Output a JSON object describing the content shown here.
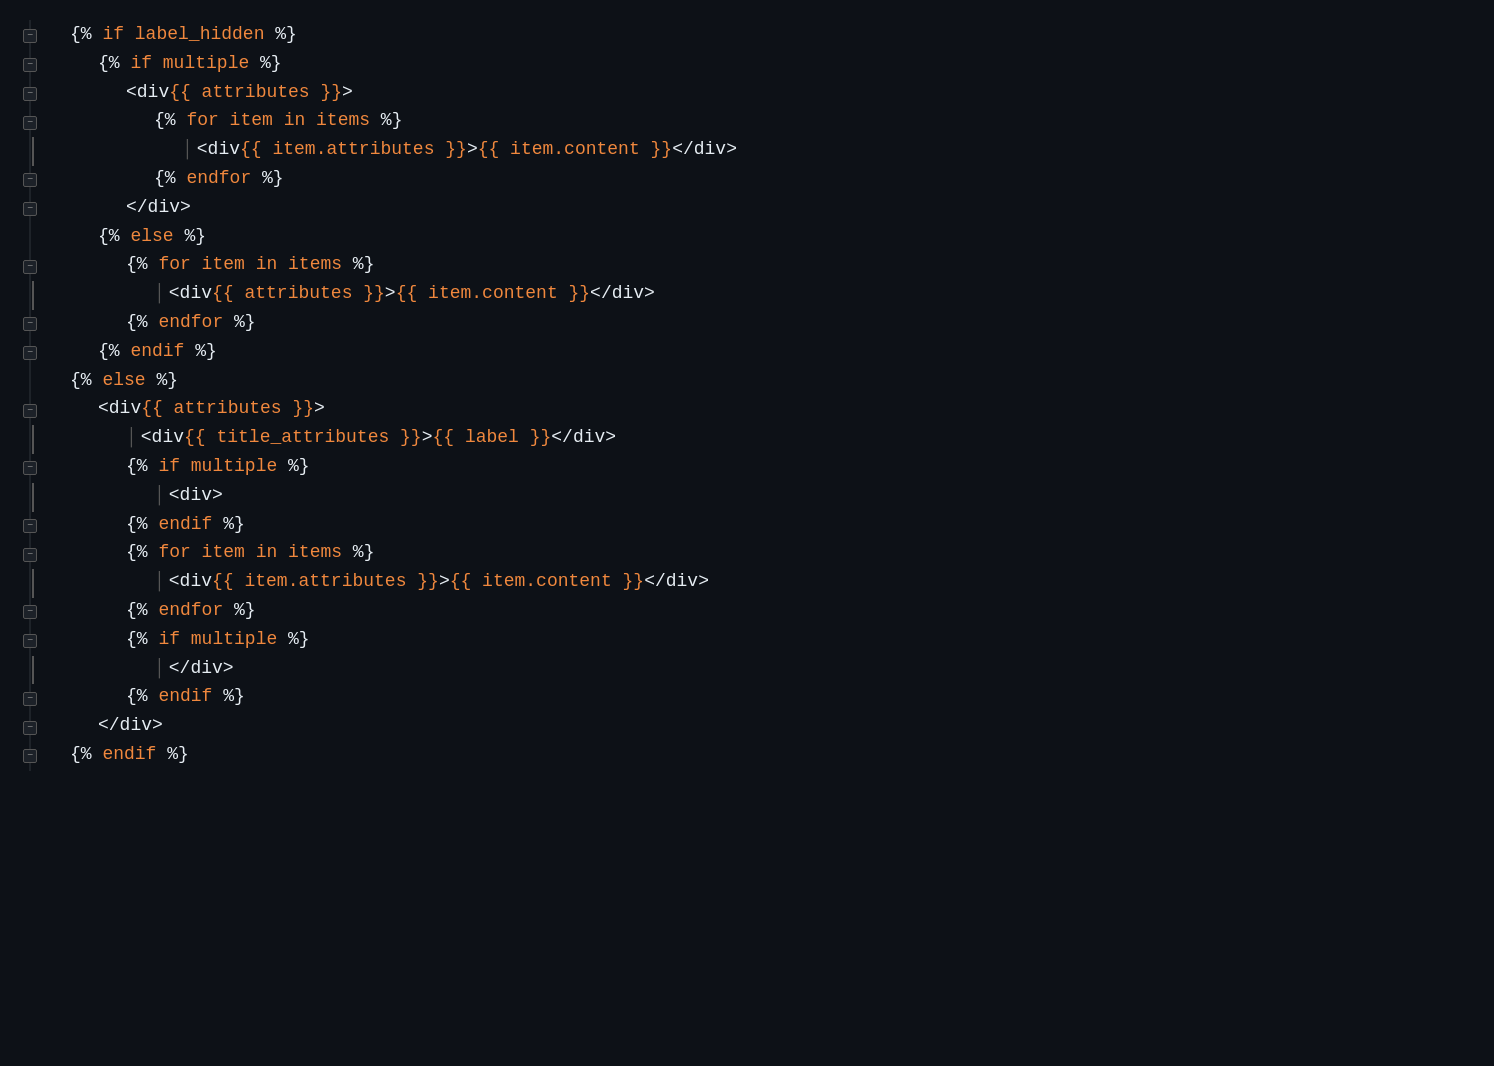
{
  "colors": {
    "bg": "#0d1117",
    "white": "#e6edf3",
    "orange": "#f0883e",
    "blue": "#79c0ff",
    "keyword": "#ff7b72",
    "gutter_line": "#30363d"
  },
  "lines": [
    {
      "indent": 0,
      "fold": "minus",
      "tokens": [
        {
          "c": "white",
          "t": "{%"
        },
        {
          "c": "orange",
          "t": " if label_hidden "
        },
        {
          "c": "white",
          "t": "%}"
        }
      ]
    },
    {
      "indent": 1,
      "fold": "minus",
      "tokens": [
        {
          "c": "white",
          "t": "{%"
        },
        {
          "c": "orange",
          "t": " if multiple "
        },
        {
          "c": "white",
          "t": "%}"
        }
      ]
    },
    {
      "indent": 2,
      "fold": "minus",
      "tokens": [
        {
          "c": "white",
          "t": "<div"
        },
        {
          "c": "orange",
          "t": "{{ attributes }}"
        },
        {
          "c": "white",
          "t": ">"
        }
      ]
    },
    {
      "indent": 3,
      "fold": "minus",
      "tokens": [
        {
          "c": "white",
          "t": "{%"
        },
        {
          "c": "orange",
          "t": " for item in items "
        },
        {
          "c": "white",
          "t": "%}"
        }
      ]
    },
    {
      "indent": 4,
      "fold": "pipe",
      "tokens": [
        {
          "c": "white",
          "t": "<div"
        },
        {
          "c": "orange",
          "t": "{{ item.attributes }}"
        },
        {
          "c": "white",
          "t": ">"
        },
        {
          "c": "orange",
          "t": "{{ item.content }}"
        },
        {
          "c": "white",
          "t": "</div>"
        }
      ]
    },
    {
      "indent": 3,
      "fold": "minus",
      "tokens": [
        {
          "c": "white",
          "t": "{%"
        },
        {
          "c": "orange",
          "t": " endfor "
        },
        {
          "c": "white",
          "t": "%}"
        }
      ]
    },
    {
      "indent": 2,
      "fold": "minus",
      "tokens": [
        {
          "c": "white",
          "t": "</div>"
        }
      ]
    },
    {
      "indent": 1,
      "fold": "none",
      "tokens": [
        {
          "c": "white",
          "t": "{%"
        },
        {
          "c": "orange",
          "t": " else "
        },
        {
          "c": "white",
          "t": "%}"
        }
      ]
    },
    {
      "indent": 2,
      "fold": "minus",
      "tokens": [
        {
          "c": "white",
          "t": "{%"
        },
        {
          "c": "orange",
          "t": " for item in items "
        },
        {
          "c": "white",
          "t": "%}"
        }
      ]
    },
    {
      "indent": 3,
      "fold": "pipe",
      "tokens": [
        {
          "c": "white",
          "t": "<div"
        },
        {
          "c": "orange",
          "t": "{{ attributes }}"
        },
        {
          "c": "white",
          "t": ">"
        },
        {
          "c": "orange",
          "t": "{{ item.content }}"
        },
        {
          "c": "white",
          "t": "</div>"
        }
      ]
    },
    {
      "indent": 2,
      "fold": "minus",
      "tokens": [
        {
          "c": "white",
          "t": "{%"
        },
        {
          "c": "orange",
          "t": " endfor "
        },
        {
          "c": "white",
          "t": "%}"
        }
      ]
    },
    {
      "indent": 1,
      "fold": "minus",
      "tokens": [
        {
          "c": "white",
          "t": "{%"
        },
        {
          "c": "orange",
          "t": " endif "
        },
        {
          "c": "white",
          "t": "%}"
        }
      ]
    },
    {
      "indent": 0,
      "fold": "none",
      "tokens": [
        {
          "c": "white",
          "t": "{%"
        },
        {
          "c": "orange",
          "t": " else "
        },
        {
          "c": "white",
          "t": "%}"
        }
      ]
    },
    {
      "indent": 1,
      "fold": "minus",
      "tokens": [
        {
          "c": "white",
          "t": "<div"
        },
        {
          "c": "orange",
          "t": "{{ attributes }}"
        },
        {
          "c": "white",
          "t": ">"
        }
      ]
    },
    {
      "indent": 2,
      "fold": "pipe",
      "tokens": [
        {
          "c": "white",
          "t": "<div"
        },
        {
          "c": "orange",
          "t": "{{ title_attributes }}"
        },
        {
          "c": "white",
          "t": ">"
        },
        {
          "c": "orange",
          "t": "{{ label }}"
        },
        {
          "c": "white",
          "t": "</div>"
        }
      ]
    },
    {
      "indent": 2,
      "fold": "minus",
      "tokens": [
        {
          "c": "white",
          "t": "{%"
        },
        {
          "c": "orange",
          "t": " if multiple "
        },
        {
          "c": "white",
          "t": "%}"
        }
      ]
    },
    {
      "indent": 3,
      "fold": "pipe",
      "tokens": [
        {
          "c": "white",
          "t": "<div>"
        }
      ]
    },
    {
      "indent": 2,
      "fold": "minus",
      "tokens": [
        {
          "c": "white",
          "t": "{%"
        },
        {
          "c": "orange",
          "t": " endif "
        },
        {
          "c": "white",
          "t": "%}"
        }
      ]
    },
    {
      "indent": 2,
      "fold": "minus",
      "tokens": [
        {
          "c": "white",
          "t": "{%"
        },
        {
          "c": "orange",
          "t": " for item in items "
        },
        {
          "c": "white",
          "t": "%}"
        }
      ]
    },
    {
      "indent": 3,
      "fold": "pipe",
      "tokens": [
        {
          "c": "white",
          "t": "<div"
        },
        {
          "c": "orange",
          "t": "{{ item.attributes }}"
        },
        {
          "c": "white",
          "t": ">"
        },
        {
          "c": "orange",
          "t": "{{ item.content }}"
        },
        {
          "c": "white",
          "t": "</div>"
        }
      ]
    },
    {
      "indent": 2,
      "fold": "minus",
      "tokens": [
        {
          "c": "white",
          "t": "{%"
        },
        {
          "c": "orange",
          "t": " endfor "
        },
        {
          "c": "white",
          "t": "%}"
        }
      ]
    },
    {
      "indent": 2,
      "fold": "minus",
      "tokens": [
        {
          "c": "white",
          "t": "{%"
        },
        {
          "c": "orange",
          "t": " if multiple "
        },
        {
          "c": "white",
          "t": "%}"
        }
      ]
    },
    {
      "indent": 3,
      "fold": "pipe",
      "tokens": [
        {
          "c": "white",
          "t": "</div>"
        }
      ]
    },
    {
      "indent": 2,
      "fold": "minus",
      "tokens": [
        {
          "c": "white",
          "t": "{%"
        },
        {
          "c": "orange",
          "t": " endif "
        },
        {
          "c": "white",
          "t": "%}"
        }
      ]
    },
    {
      "indent": 1,
      "fold": "minus",
      "tokens": [
        {
          "c": "white",
          "t": "</div>"
        }
      ]
    },
    {
      "indent": 0,
      "fold": "minus",
      "tokens": [
        {
          "c": "white",
          "t": "{%"
        },
        {
          "c": "orange",
          "t": " endif "
        },
        {
          "c": "white",
          "t": "%}"
        }
      ]
    }
  ]
}
